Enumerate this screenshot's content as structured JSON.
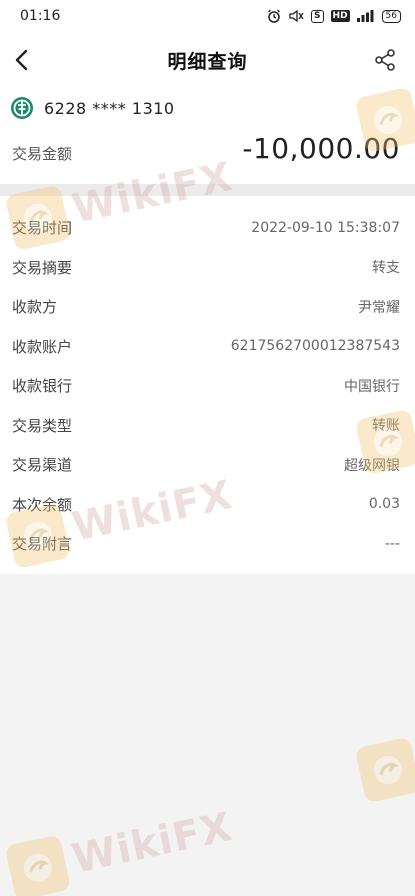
{
  "status_bar": {
    "time": "01:16",
    "icons": [
      "alarm-icon",
      "mute-icon",
      "s-icon",
      "hd-icon",
      "signal-icon",
      "battery-icon"
    ],
    "s_label": "S",
    "hd_label": "HD",
    "battery_level": "56"
  },
  "header": {
    "title": "明细查询",
    "back_icon": "chevron-left-icon",
    "share_icon": "share-icon"
  },
  "account": {
    "number": "6228 **** 1310",
    "amount_label": "交易金额",
    "amount_value": "-10,000.00",
    "logo_color": "#1a8a6a"
  },
  "details": [
    {
      "label": "交易时间",
      "value": "2022-09-10 15:38:07"
    },
    {
      "label": "交易摘要",
      "value": "转支"
    },
    {
      "label": "收款方",
      "value": "尹常耀"
    },
    {
      "label": "收款账户",
      "value": "6217562700012387543"
    },
    {
      "label": "收款银行",
      "value": "中国银行"
    },
    {
      "label": "交易类型",
      "value": "转账"
    },
    {
      "label": "交易渠道",
      "value": "超级网银"
    },
    {
      "label": "本次余额",
      "value": "0.03"
    },
    {
      "label": "交易附言",
      "value": "---"
    }
  ],
  "watermark": {
    "text": "WikiFX"
  }
}
